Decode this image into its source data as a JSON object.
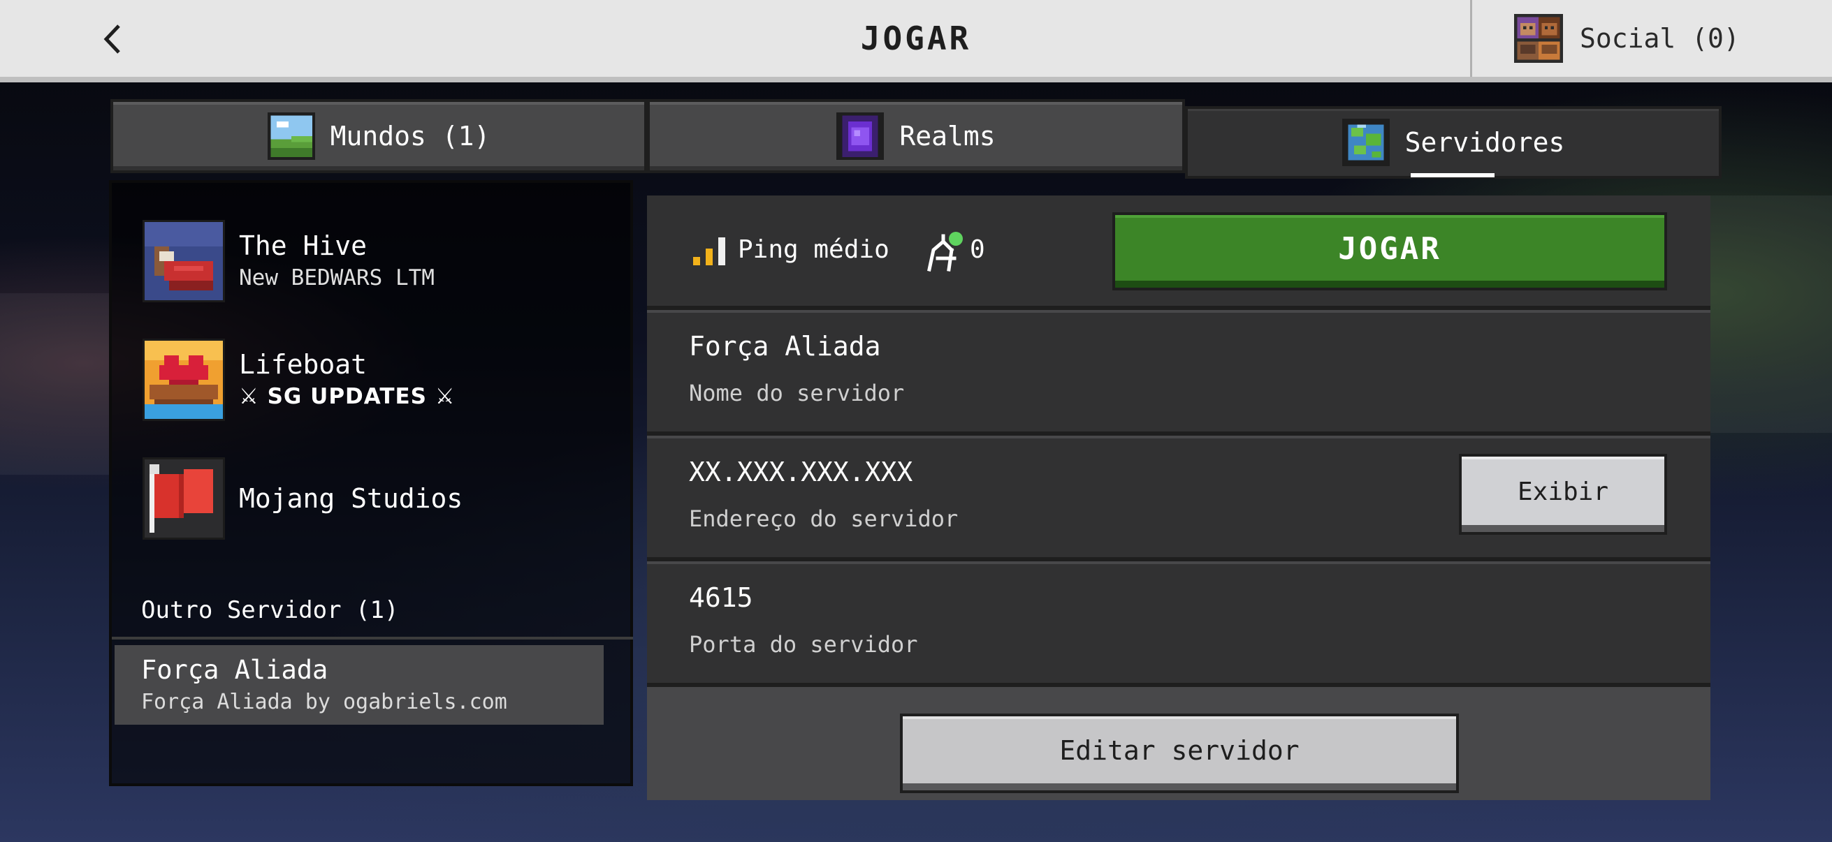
{
  "header": {
    "title": "JOGAR",
    "social_label": "Social (0)"
  },
  "tabs": [
    {
      "label": "Mundos (1)",
      "icon": "world-landscape-icon"
    },
    {
      "label": "Realms",
      "icon": "realms-portal-icon"
    },
    {
      "label": "Servidores",
      "icon": "globe-icon",
      "active": true
    }
  ],
  "featured_servers": [
    {
      "name": "The Hive",
      "subtitle": "New BEDWARS LTM",
      "icon": "bed-icon"
    },
    {
      "name": "Lifeboat",
      "subtitle": "⚔ SG UPDATES ⚔",
      "icon": "heart-boat-icon"
    },
    {
      "name": "Mojang Studios",
      "subtitle": "",
      "icon": "red-flag-icon"
    }
  ],
  "other_servers": {
    "section_label": "Outro Servidor (1)",
    "items": [
      {
        "name": "Força Aliada",
        "subtitle": "Força Aliada by ogabriels.com",
        "selected": true
      }
    ]
  },
  "details": {
    "ping_label": "Ping médio",
    "players_count": "0",
    "join_label": "JOGAR",
    "server_name_value": "Força Aliada",
    "server_name_label": "Nome do servidor",
    "server_address_value": "XX.XXX.XXX.XXX",
    "server_address_label": "Endereço do servidor",
    "show_label": "Exibir",
    "server_port_value": "4615",
    "server_port_label": "Porta do servidor",
    "edit_label": "Editar servidor"
  },
  "colors": {
    "join_button": "#3c8527",
    "panel": "#313132",
    "topbar": "#e6e6e6",
    "ping_bars": "#f2b21b"
  }
}
